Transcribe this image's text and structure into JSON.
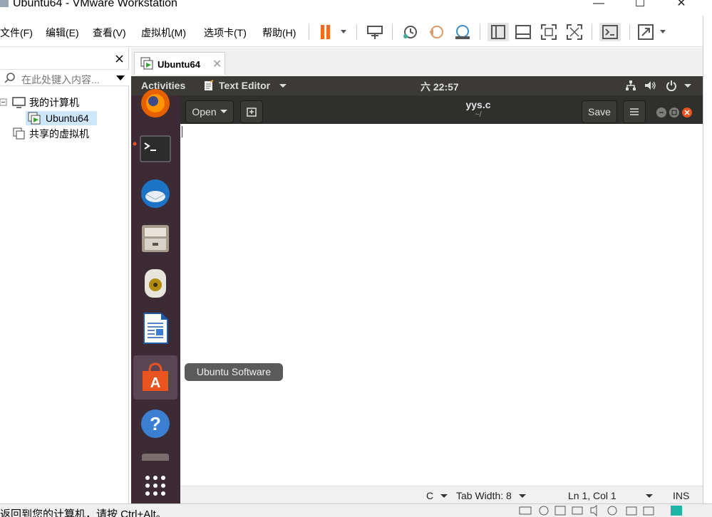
{
  "window": {
    "title": "Ubuntu64 - VMware Workstation",
    "minimize": "—",
    "maximize": "☐",
    "close": "✕"
  },
  "menu": [
    "文件(F)",
    "编辑(E)",
    "查看(V)",
    "虚拟机(M)",
    "选项卡(T)",
    "帮助(H)"
  ],
  "library": {
    "search_placeholder": "在此处键入内容...",
    "tree": [
      {
        "label": "我的计算机"
      },
      {
        "label": "Ubuntu64"
      },
      {
        "label": "共享的虚拟机"
      }
    ]
  },
  "tab": {
    "label": "Ubuntu64",
    "close": "✕"
  },
  "ubuntu": {
    "activities": "Activities",
    "app_menu": "Text Editor",
    "clock": "六 22:57",
    "gedit": {
      "open": "Open",
      "title": "yys.c",
      "subtitle": "~/",
      "save": "Save"
    },
    "status": {
      "language": "C",
      "tab_width": "Tab Width: 8",
      "position": "Ln 1, Col 1",
      "mode": "INS"
    },
    "tooltip": "Ubuntu Software",
    "dock_items": [
      "firefox-icon",
      "terminal-icon",
      "thunderbird-icon",
      "files-icon",
      "rhythmbox-icon",
      "libreoffice-writer-icon",
      "ubuntu-software-icon",
      "help-icon",
      "show-apps-icon"
    ]
  },
  "statusbar": {
    "text": "返回到您的计算机，请按 Ctrl+Alt。"
  }
}
